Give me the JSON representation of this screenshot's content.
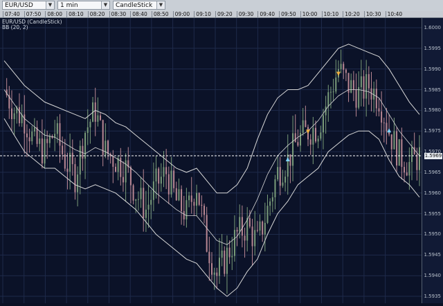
{
  "toolbar": {
    "symbol": "EUR/USD",
    "interval": "1 min",
    "chart_type": "CandleStick",
    "colors": {
      "bg": "#c9cfd6"
    }
  },
  "time_axis": [
    "07:40",
    "07:50",
    "08:00",
    "08:10",
    "08:20",
    "08:30",
    "08:40",
    "08:50",
    "09:00",
    "09:10",
    "09:20",
    "09:30",
    "09:40",
    "09:50",
    "10:00",
    "10:10",
    "10:20",
    "10:30",
    "10:40"
  ],
  "chart": {
    "title": "EUR/USD (CandleStick)",
    "indicator": "BB (20, 2)",
    "current_price": "1.5969",
    "price_labels": [
      "1.6000",
      "1.5995",
      "1.5990",
      "1.5985",
      "1.5980",
      "1.5975",
      "1.5970",
      "1.5965",
      "1.5960",
      "1.5955",
      "1.5950",
      "1.5945",
      "1.5940",
      "1.5935"
    ],
    "colors": {
      "background": "#0b1228",
      "grid": "#1e2a4a",
      "bull": "#7a9c7a",
      "bear": "#b98793",
      "bands": "#d8d8d8",
      "signal_up": "#7fd4ff",
      "signal_down": "#f0b040"
    }
  },
  "chart_data": {
    "type": "candlestick",
    "title": "EUR/USD (CandleStick)",
    "x_range": [
      "07:37",
      "10:42"
    ],
    "ylim": [
      1.5933,
      1.6002
    ],
    "grid": true,
    "series": [
      {
        "name": "EUR/USD",
        "values": [
          1.5985,
          1.598,
          1.5978,
          1.5972,
          1.597,
          1.5975,
          1.5968,
          1.5964,
          1.5975,
          1.598,
          1.597,
          1.5968,
          1.5966,
          1.596,
          1.5956,
          1.5962,
          1.5965,
          1.5958,
          1.5955,
          1.5962,
          1.5948,
          1.594,
          1.5945,
          1.595,
          1.5952,
          1.5948,
          1.5956,
          1.5965,
          1.5968,
          1.5973,
          1.5975,
          1.5976,
          1.5983,
          1.599,
          1.5986,
          1.5984,
          1.5986,
          1.5983,
          1.5975,
          1.5969,
          1.5967,
          1.5969
        ]
      }
    ],
    "bollinger": {
      "upper": [
        1.5992,
        1.5989,
        1.5986,
        1.5984,
        1.5982,
        1.5981,
        1.598,
        1.5979,
        1.5978,
        1.598,
        1.5979,
        1.5977,
        1.5976,
        1.5974,
        1.5972,
        1.597,
        1.5968,
        1.5966,
        1.5965,
        1.5966,
        1.5963,
        1.596,
        1.596,
        1.5962,
        1.5966,
        1.5973,
        1.5979,
        1.5983,
        1.5985,
        1.5985,
        1.5986,
        1.5989,
        1.5992,
        1.5995,
        1.5996,
        1.5995,
        1.5994,
        1.5993,
        1.599,
        1.5986,
        1.5982,
        1.5979
      ],
      "lower": [
        1.5978,
        1.5974,
        1.597,
        1.5968,
        1.5966,
        1.5966,
        1.5964,
        1.5962,
        1.5961,
        1.5962,
        1.5961,
        1.596,
        1.5958,
        1.5956,
        1.5953,
        1.595,
        1.5948,
        1.5946,
        1.5944,
        1.5943,
        1.594,
        1.5937,
        1.5935,
        1.5937,
        1.5941,
        1.5944,
        1.595,
        1.5955,
        1.5958,
        1.5962,
        1.5964,
        1.5966,
        1.597,
        1.5972,
        1.5974,
        1.5975,
        1.5975,
        1.5973,
        1.5968,
        1.5964,
        1.5962,
        1.5959
      ]
    },
    "signals": [
      {
        "type": "up",
        "x_index": 28,
        "y": 1.5968
      },
      {
        "type": "down",
        "x_index": 30,
        "y": 1.5975
      },
      {
        "type": "down",
        "x_index": 33,
        "y": 1.5989
      },
      {
        "type": "up",
        "x_index": 38,
        "y": 1.5975
      }
    ]
  }
}
